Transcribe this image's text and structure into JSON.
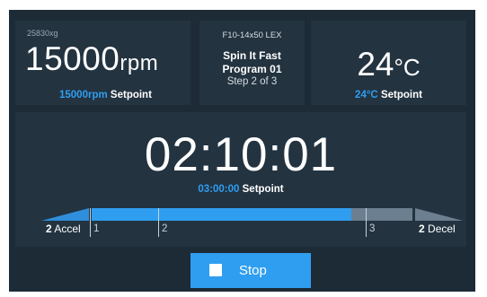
{
  "speed": {
    "rcf": "25830xg",
    "current_value": "15000",
    "current_unit": "rpm",
    "setpoint_value": "15000rpm",
    "setpoint_label": "Setpoint"
  },
  "program": {
    "rotor": "F10-14x50 LEX",
    "name": "Spin It Fast",
    "number": "Program 01",
    "step": "Step 2 of 3"
  },
  "temperature": {
    "current_value": "24",
    "current_unit": "°C",
    "setpoint_value": "24°C",
    "setpoint_label": "Setpoint"
  },
  "timer": {
    "remaining": "02:10:01",
    "setpoint_value": "03:00:00",
    "setpoint_label": "Setpoint"
  },
  "progress": {
    "fraction_complete": 0.81,
    "steps": [
      "1",
      "2",
      "3"
    ],
    "accel_value": "2",
    "accel_label": "Accel",
    "decel_value": "2",
    "decel_label": "Decel"
  },
  "controls": {
    "stop_label": "Stop",
    "stop_icon": "stop-square-icon"
  },
  "colors": {
    "background": "#1d2b36",
    "panel": "#233340",
    "accent": "#2f9ef0",
    "track": "#6c7f90"
  }
}
